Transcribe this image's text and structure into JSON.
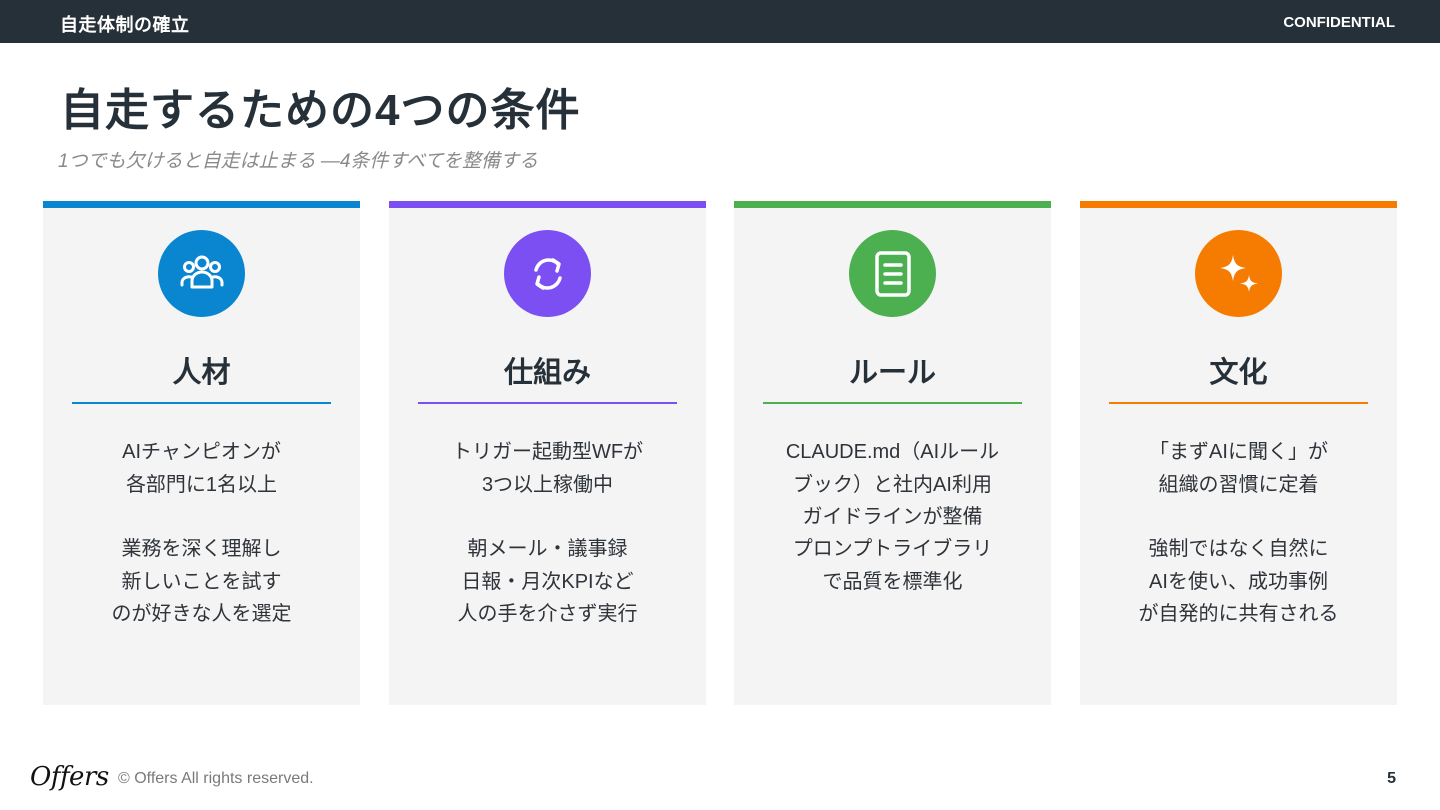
{
  "header": {
    "section": "自走体制の確立",
    "confidential": "CONFIDENTIAL"
  },
  "title": "自走するための4つの条件",
  "subtitle": "1つでも欠けると自走は止まる ―4条件すべてを整備する",
  "cards": [
    {
      "icon": "people-group-icon",
      "color": "#0a85cf",
      "heading": "人材",
      "desc1": [
        "AIチャンピオンが",
        "各部門に1名以上"
      ],
      "desc2": [
        "業務を深く理解し",
        "新しいことを試す",
        "のが好きな人を選定"
      ]
    },
    {
      "icon": "refresh-cycle-icon",
      "color": "#7b4ff2",
      "heading": "仕組み",
      "desc1": [
        "トリガー起動型WFが",
        "3つ以上稼働中"
      ],
      "desc2": [
        "朝メール・議事録",
        "日報・月次KPIなど",
        "人の手を介さず実行"
      ]
    },
    {
      "icon": "document-icon",
      "color": "#4caf50",
      "heading": "ルール",
      "desc1": [
        "CLAUDE.md（AIルール",
        "ブック）と社内AI利用",
        "ガイドラインが整備"
      ],
      "desc2": [
        "プロンプトライブラリ",
        "で品質を標準化"
      ]
    },
    {
      "icon": "sparkles-icon",
      "color": "#f57c00",
      "heading": "文化",
      "desc1": [
        "「まずAIに聞く」が",
        "組織の習慣に定着"
      ],
      "desc2": [
        "強制ではなく自然に",
        "AIを使い、成功事例",
        "が自発的に共有される"
      ]
    }
  ],
  "footer": {
    "logo": "Offers",
    "copyright": "© Offers All rights reserved.",
    "page": "5"
  }
}
